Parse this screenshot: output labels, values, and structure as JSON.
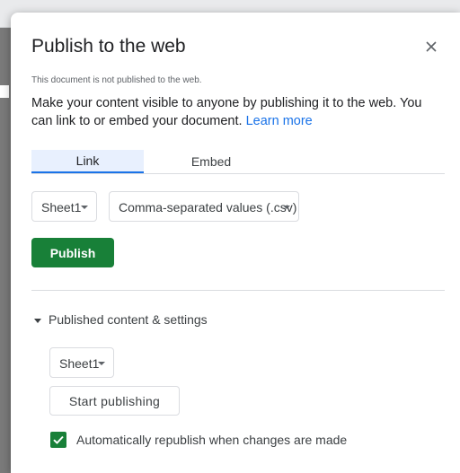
{
  "dialog": {
    "title": "Publish to the web",
    "close_icon": "close-icon",
    "status_note": "This document is not published to the web.",
    "description": "Make your content visible to anyone by publishing it to the web. You can link to or embed your document.",
    "learn_more": "Learn more"
  },
  "tabs": [
    {
      "label": "Link",
      "selected": true
    },
    {
      "label": "Embed",
      "selected": false
    }
  ],
  "publish_options": {
    "sheet_select": "Sheet1",
    "format_select": "Comma-separated values (.csv)",
    "publish_button": "Publish"
  },
  "settings": {
    "expander_label": "Published content & settings",
    "sheet_select": "Sheet1",
    "start_button": "Start publishing",
    "auto_republish_label": "Automatically republish when changes are made",
    "auto_republish_checked": true
  },
  "colors": {
    "accent": "#1a73e8",
    "primary_button": "#188038"
  }
}
